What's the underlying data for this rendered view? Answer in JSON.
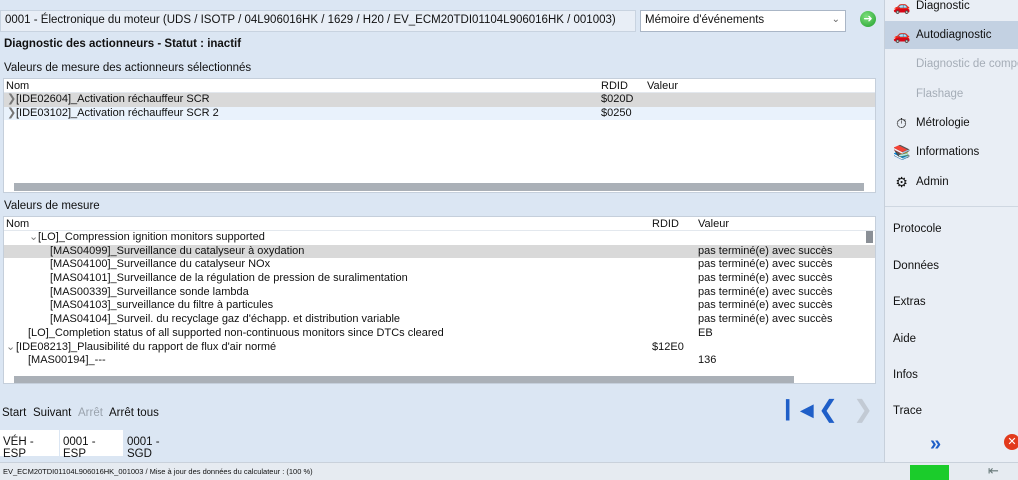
{
  "header": {
    "title": "0001 - Électronique du moteur  (UDS / ISOTP / 04L906016HK / 1629 / H20 / EV_ECM20TDI01104L906016HK / 001003)",
    "mode_select": "Mémoire d'événements"
  },
  "status_line": "Diagnostic des actionneurs - Statut : inactif",
  "actuators": {
    "section_title": "Valeurs de mesure des actionneurs sélectionnés",
    "columns": {
      "name": "Nom",
      "rdid": "RDID",
      "value": "Valeur"
    },
    "rows": [
      {
        "name": "[IDE02604]_Activation réchauffeur SCR",
        "rdid": "$020D",
        "value": ""
      },
      {
        "name": "[IDE03102]_Activation réchauffeur SCR 2",
        "rdid": "$0250",
        "value": ""
      }
    ]
  },
  "measures": {
    "section_title": "Valeurs de mesure",
    "columns": {
      "name": "Nom",
      "rdid": "RDID",
      "value": "Valeur"
    },
    "rows": [
      {
        "name": "[LO]_Compression ignition monitors supported",
        "rdid": "",
        "value": ""
      },
      {
        "name": "[MAS04099]_Surveillance du catalyseur à oxydation",
        "rdid": "",
        "value": "pas terminé(e) avec succès"
      },
      {
        "name": "[MAS04100]_Surveillance du catalyseur NOx",
        "rdid": "",
        "value": "pas terminé(e) avec succès"
      },
      {
        "name": "[MAS04101]_Surveillance de la régulation de pression de suralimentation",
        "rdid": "",
        "value": "pas terminé(e) avec succès"
      },
      {
        "name": "[MAS00339]_Surveillance sonde lambda",
        "rdid": "",
        "value": "pas terminé(e) avec succès"
      },
      {
        "name": "[MAS04103]_surveillance du filtre à particules",
        "rdid": "",
        "value": "pas terminé(e) avec succès"
      },
      {
        "name": "[MAS04104]_Surveil. du recyclage gaz d'échapp. et distribution variable",
        "rdid": "",
        "value": "pas terminé(e) avec succès"
      },
      {
        "name": "[LO]_Completion status of all supported non-continuous monitors since DTCs cleared",
        "rdid": "",
        "value": "EB"
      },
      {
        "name": "[IDE08213]_Plausibilité du rapport de flux d'air normé",
        "rdid": "$12E0",
        "value": ""
      },
      {
        "name": "[MAS00194]_---",
        "rdid": "",
        "value": "136"
      }
    ]
  },
  "buttons": {
    "start": "Start",
    "next": "Suivant",
    "stop": "Arrêt",
    "stop_all": "Arrêt tous"
  },
  "tabs": [
    "VÉH - ESP",
    "0001 - ESP",
    "0001 - SGD"
  ],
  "statusbar": "EV_ECM20TDI01104L906016HK_001003 / Mise à jour des données du calculateur : (100 %)",
  "sidebar": {
    "items": [
      {
        "label": "Diagnostic",
        "icon": "diagnostic-icon",
        "state": "normal"
      },
      {
        "label": "Autodiagnostic",
        "icon": "autodiag-icon",
        "state": "active"
      },
      {
        "label": "Diagnostic de compo",
        "icon": "component-diag-icon",
        "state": "disabled"
      },
      {
        "label": "Flashage",
        "icon": "flash-icon",
        "state": "disabled"
      },
      {
        "label": "Métrologie",
        "icon": "gauge-icon",
        "state": "normal"
      },
      {
        "label": "Informations",
        "icon": "books-icon",
        "state": "normal"
      },
      {
        "label": "Admin",
        "icon": "gear-icon",
        "state": "normal"
      }
    ],
    "groups": [
      "Protocole",
      "Données",
      "Extras",
      "Aide",
      "Infos",
      "Trace"
    ]
  },
  "colors": {
    "accent_blue": "#1f5fc8",
    "ok_green": "#1bcc2b",
    "close_red": "#e23a1c",
    "active_item": "#c3d1e2"
  }
}
